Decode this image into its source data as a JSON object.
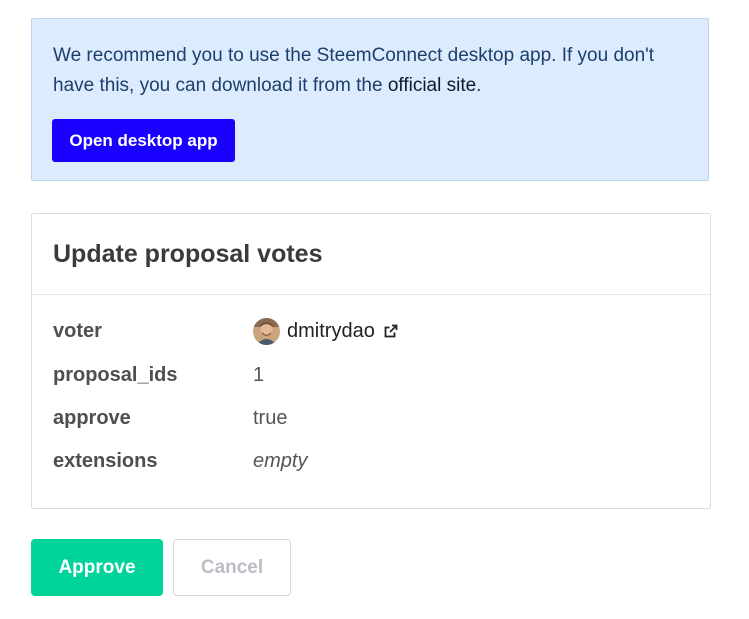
{
  "notice": {
    "text_before": "We recommend you to use the SteemConnect desktop app. If you don't have this, you can download it from the ",
    "link_label": "official site",
    "text_after": ".",
    "button_label": "Open desktop app",
    "bg_color": "#dcebfd",
    "button_color": "#1a00ff"
  },
  "operation": {
    "title": "Update proposal votes",
    "fields": [
      {
        "key": "voter",
        "value": "dmitrydao",
        "type": "account",
        "icon": "external-link-icon"
      },
      {
        "key": "proposal_ids",
        "value": "1",
        "type": "text"
      },
      {
        "key": "approve",
        "value": "true",
        "type": "text"
      },
      {
        "key": "extensions",
        "value": "empty",
        "type": "empty"
      }
    ]
  },
  "actions": {
    "approve_label": "Approve",
    "cancel_label": "Cancel",
    "approve_color": "#00d49b"
  }
}
